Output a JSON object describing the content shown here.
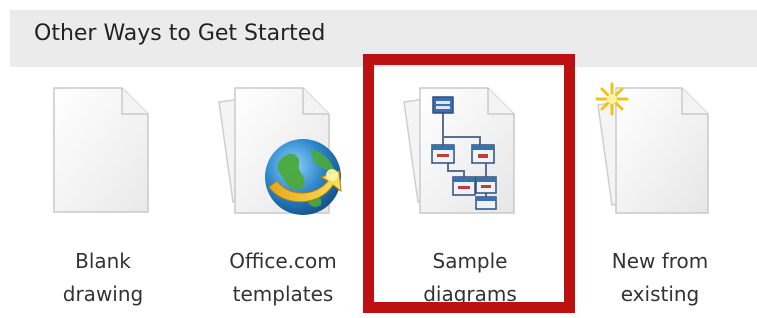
{
  "section": {
    "title": "Other Ways to Get Started"
  },
  "tiles": [
    {
      "line1": "Blank",
      "line2": "drawing",
      "icon": "blank-document-icon"
    },
    {
      "line1": "Office.com",
      "line2": "templates",
      "icon": "office-globe-icon"
    },
    {
      "line1": "Sample",
      "line2": "diagrams",
      "icon": "sample-diagram-icon"
    },
    {
      "line1": "New from",
      "line2": "existing",
      "icon": "new-from-existing-icon"
    }
  ],
  "highlight": {
    "color": "#bd1111",
    "target": "Sample diagrams"
  }
}
